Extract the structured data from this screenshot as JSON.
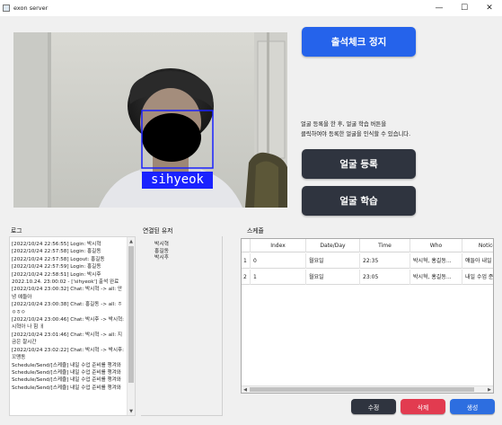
{
  "window": {
    "title": "exon server",
    "controls": {
      "minimize": "—",
      "maximize": "☐",
      "close": "✕"
    }
  },
  "camera": {
    "detected_name": "sihyeok",
    "box_color": "#1a22ff"
  },
  "buttons": {
    "attendance_stop": "출석체크 정지",
    "face_register": "얼굴 등록",
    "face_train": "얼굴 학습",
    "edit": "수정",
    "delete": "삭제",
    "create": "생성"
  },
  "info_text": {
    "line1": "얼굴 등록을 한 후, 얼굴 학습 버튼을",
    "line2": "클릭하여야 등록한 얼굴을 인식할 수 있습니다."
  },
  "labels": {
    "log": "로그",
    "connected_users": "연결된 유저",
    "schedule": "스케쥴"
  },
  "log_lines": [
    "[2022/10/24 22:56:55] Login: 박시혁",
    "[2022/10/24 22:57:58] Login: 홍길동",
    "[2022/10/24 22:57:58] Logout: 홍길동",
    "[2022/10/24 22:57:59] Login: 홍길동",
    "[2022/10/24 22:58:51] Login: 박시후",
    "2022.10.24. 23:00:02 - ['sihyeok'] 출석 완료",
    "[2022/10/24 23:00:32] Chat: 박시혁 -> all: 안녕 얘들아",
    "[2022/10/24 23:00:38] Chat: 홍길동 -> all: ㅎㅇㅎㅇ",
    "[2022/10/24 23:00:46] Chat: 박시후 -> 박시혁: 시혁아 나 힘 ㅐ",
    "[2022/10/24 23:01:46] Chat: 박시혁 -> all: 지금은 잘시간",
    "[2022/10/24 23:02:22] Chat: 박시혁 -> 박시후: 꼬맹동",
    "Schedule/Send/[스케쥴] 내일 수업 준비를 챙겨와",
    "Schedule/Send/[스케쥴] 내일 수업 준비를 챙겨와",
    "Schedule/Send/[스케쥴] 내일 수업 준비를 챙겨와",
    "Schedule/Send/[스케쥴] 내일 수업 준비를 챙겨와"
  ],
  "connected_users": [
    "박시혁",
    "홍길동",
    "박시후"
  ],
  "schedule": {
    "columns": [
      "Index",
      "Date/Day",
      "Time",
      "Who",
      "Notice"
    ],
    "rows": [
      {
        "row_no": "1",
        "index": "0",
        "day": "월요일",
        "time": "22:35",
        "who": "박시혁, 홍길동...",
        "notice": "얘들아 내일 수..."
      },
      {
        "row_no": "2",
        "index": "1",
        "day": "월요일",
        "time": "23:05",
        "who": "박시혁, 홍길동...",
        "notice": "내일 수업 준비..."
      }
    ]
  },
  "colors": {
    "primary": "#2563eb",
    "dark": "#2f343f",
    "delete": "#e23b50",
    "create": "#2d6ee0",
    "edit": "#2f343f"
  }
}
